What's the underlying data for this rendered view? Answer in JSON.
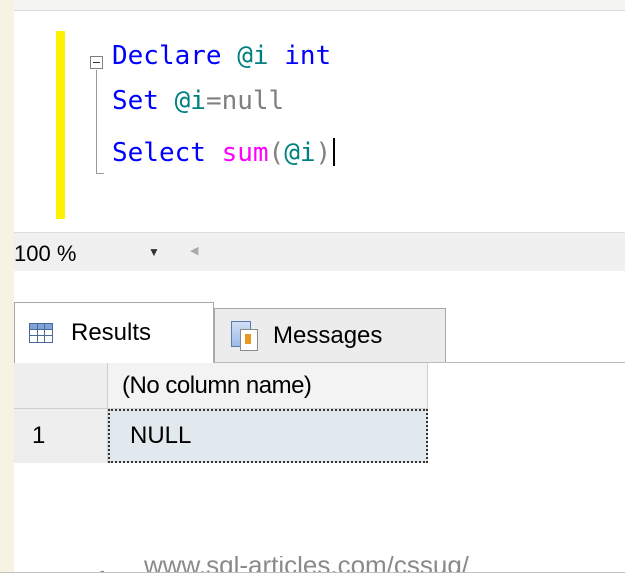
{
  "editor": {
    "line1": {
      "keyword": "Declare",
      "variable": "@i",
      "type": "int"
    },
    "line2": {
      "keyword": "Set",
      "variable": "@i",
      "operator": "=",
      "value": "null"
    },
    "line3": {
      "keyword": "Select",
      "function": "sum",
      "open": "(",
      "variable": "@i",
      "close": ")"
    }
  },
  "zoom": {
    "value": "100 %",
    "dropdown_icon": "chevron-down-icon"
  },
  "tabs": [
    {
      "label": "Results",
      "icon": "results-grid-icon",
      "active": true
    },
    {
      "label": "Messages",
      "icon": "messages-icon",
      "active": false
    }
  ],
  "results": {
    "columns": [
      "(No column name)"
    ],
    "rows": [
      {
        "num": "1",
        "values": [
          "NULL"
        ]
      }
    ]
  },
  "footer": {
    "url": "www.sql-articles.com/cssug/"
  },
  "colors": {
    "keyword": "#0000ff",
    "variable": "#008080",
    "function": "#ff00ff",
    "operator": "#808080",
    "change_bar": "#fff200",
    "selected_cell": "#e1e8ee"
  }
}
